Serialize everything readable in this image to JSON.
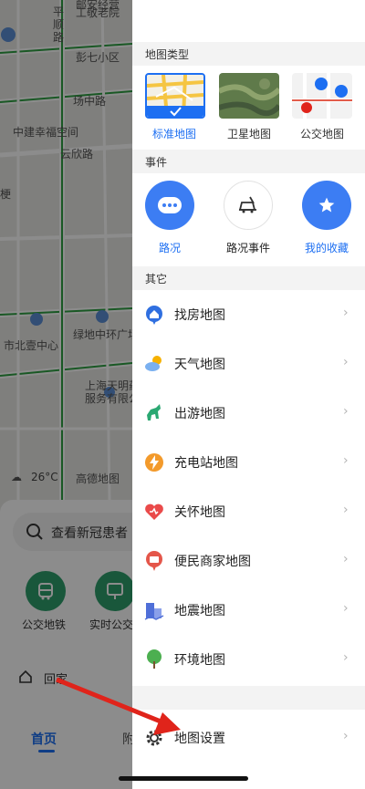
{
  "map": {
    "labels": {
      "top_col_1": "平",
      "top_col_2": "顺",
      "top_col_3": "路",
      "top_row_1": "邮安经营",
      "top_row_2": "工敬老院",
      "district": "彭七小区",
      "road_1": "场中路",
      "place_1": "中建幸福空间",
      "road_2": "云欣路",
      "left_edge": "梗",
      "place_2": "绿地中环广场",
      "place_3": "市北壹中心",
      "place_4": "上海天明药",
      "place_5": "服务有限公",
      "weather": "26°C",
      "watermark": "高德地图"
    },
    "bottom_card": {
      "search_placeholder": "查看新冠患者",
      "quick_1": "公交地铁",
      "quick_2": "实时公交",
      "home_label": "回家",
      "nav_home": "首页",
      "nav_next": "附"
    }
  },
  "drawer": {
    "section_map_type": "地图类型",
    "map_types": [
      {
        "label": "标准地图",
        "selected": true
      },
      {
        "label": "卫星地图",
        "selected": false
      },
      {
        "label": "公交地图",
        "selected": false
      }
    ],
    "section_events": "事件",
    "events": [
      {
        "label": "路况",
        "icon": "more-dots-icon"
      },
      {
        "label": "路况事件",
        "icon": "car-warning-icon"
      },
      {
        "label": "我的收藏",
        "icon": "star-icon"
      }
    ],
    "section_other": "其它",
    "other_items": [
      {
        "label": "找房地图",
        "icon": "house-location-icon"
      },
      {
        "label": "天气地图",
        "icon": "weather-cloud-sun-icon"
      },
      {
        "label": "出游地图",
        "icon": "horse-icon"
      },
      {
        "label": "充电站地图",
        "icon": "charging-bolt-icon"
      },
      {
        "label": "关怀地图",
        "icon": "heart-icon"
      },
      {
        "label": "便民商家地图",
        "icon": "shop-pin-icon"
      },
      {
        "label": "地震地图",
        "icon": "earthquake-building-icon"
      },
      {
        "label": "环境地图",
        "icon": "tree-icon"
      }
    ],
    "settings": {
      "label": "地图设置",
      "icon": "gear-icon"
    },
    "chevron": "›"
  },
  "colors": {
    "accent_blue": "#1d6ff2",
    "event_blue": "#3c7df3",
    "green": "#2e9e6c",
    "arrow_red": "#e0241b"
  }
}
